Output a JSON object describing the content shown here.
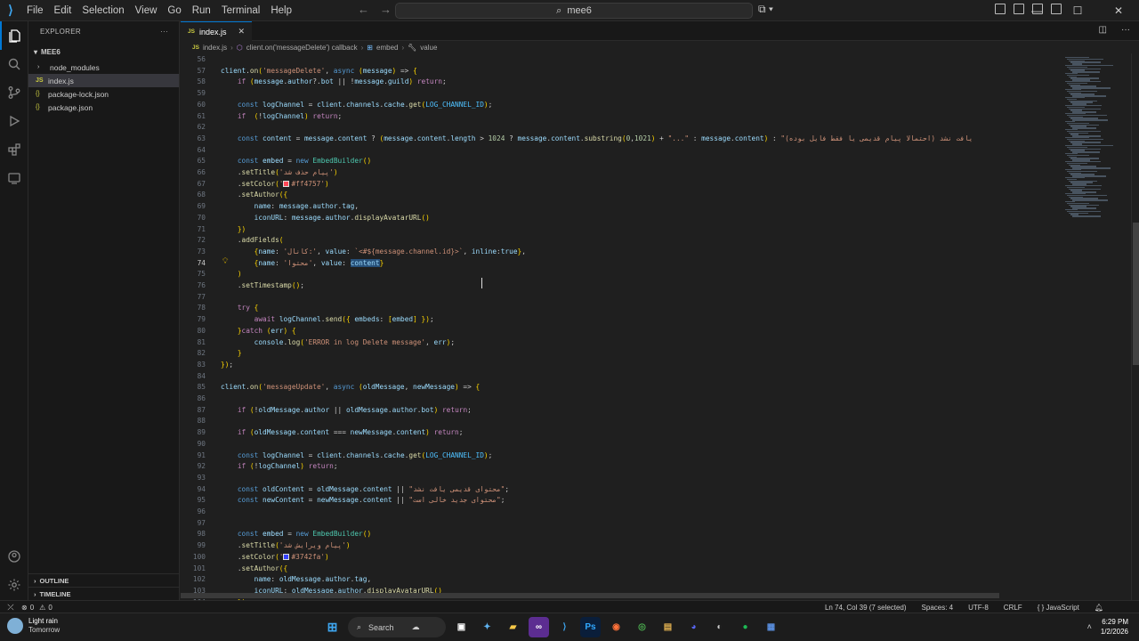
{
  "menu": {
    "items": [
      "File",
      "Edit",
      "Selection",
      "View",
      "Go",
      "Run",
      "Terminal",
      "Help"
    ]
  },
  "search": {
    "text": "mee6"
  },
  "sidebar": {
    "title": "EXPLORER",
    "root": "MEE6",
    "items": [
      {
        "label": "node_modules",
        "kind": "folder"
      },
      {
        "label": "index.js",
        "kind": "js",
        "selected": true
      },
      {
        "label": "package-lock.json",
        "kind": "json"
      },
      {
        "label": "package.json",
        "kind": "json"
      }
    ],
    "outline": "OUTLINE",
    "timeline": "TIMELINE"
  },
  "tab": {
    "label": "index.js",
    "icon": "JS"
  },
  "breadcrumb": {
    "file": "index.js",
    "fn": "client.on('messageDelete') callback",
    "obj": "embed",
    "prop": "value"
  },
  "status": {
    "errors": "0",
    "warnings": "0",
    "cursor": "Ln 74, Col 39 (7 selected)",
    "spaces": "Spaces: 4",
    "encoding": "UTF-8",
    "eol": "CRLF",
    "language": "JavaScript"
  },
  "taskbar": {
    "weather": "Light rain",
    "weather_sub": "Tomorrow",
    "search": "Search",
    "time": "6:29 PM",
    "date": "1/2/2026"
  },
  "editor": {
    "first_line": 56,
    "current_line": 74,
    "lines": [
      "",
      "client.on('messageDelete', async (message) => {",
      "    if (message.author?.bot || !message.guild) return;",
      "",
      "    const logChannel = client.channels.cache.get(LOG_CHANNEL_ID);",
      "    if  (!logChannel) return;",
      "",
      "    const content = message.content ? (message.content.length > 1024 ? message.content.substring(0,1021) + \"...\" : message.content) : \"(احتمالا پیام قدیمی یا فقط فایل بوده) یافت نشد",
      "",
      "    const embed = new EmbedBuilder()",
      "    .setTitle('پیام حذف شد')",
      "    .setColor('#ff4757')",
      "    .setAuthor({",
      "        name: message.author.tag,",
      "        iconURL: message.author.displayAvatarURL()",
      "    })",
      "    .addFields(",
      "        {name: 'کانال:', value: `<#${message.channel.id}>`, inline:true},",
      "        {name: 'محتوا', value: content}",
      "    )",
      "    .setTimestamp();",
      "",
      "    try {",
      "        await logChannel.send({ embeds: [embed] });",
      "    }catch (err) {",
      "        console.log('ERROR in log Delete message', err);",
      "    }",
      "});",
      "",
      "client.on('messageUpdate', async (oldMessage, newMessage) => {",
      "",
      "    if (!oldMessage.author || oldMessage.author.bot) return;",
      "",
      "    if (oldMessage.content === newMessage.content) return;",
      "",
      "    const logChannel = client.channels.cache.get(LOG_CHANNEL_ID);",
      "    if (!logChannel) return;",
      "",
      "    const oldContent = oldMessage.content || \"محتوای قدیمی یافت نشد\";",
      "    const newContent = newMessage.content || \"محتوای جدید خالی است\";",
      "",
      "",
      "    const embed = new EmbedBuilder()",
      "    .setTitle('پیام ویرایش شد')",
      "    .setColor('#3742fa')",
      "    .setAuthor({",
      "        name: oldMessage.author.tag,",
      "        iconURL: oldMessage.author.displayAvatarURL()",
      "    })"
    ]
  },
  "colors": {
    "accent": "#0078d4",
    "red_swatch": "#ff4757",
    "blue_swatch": "#3742fa"
  }
}
